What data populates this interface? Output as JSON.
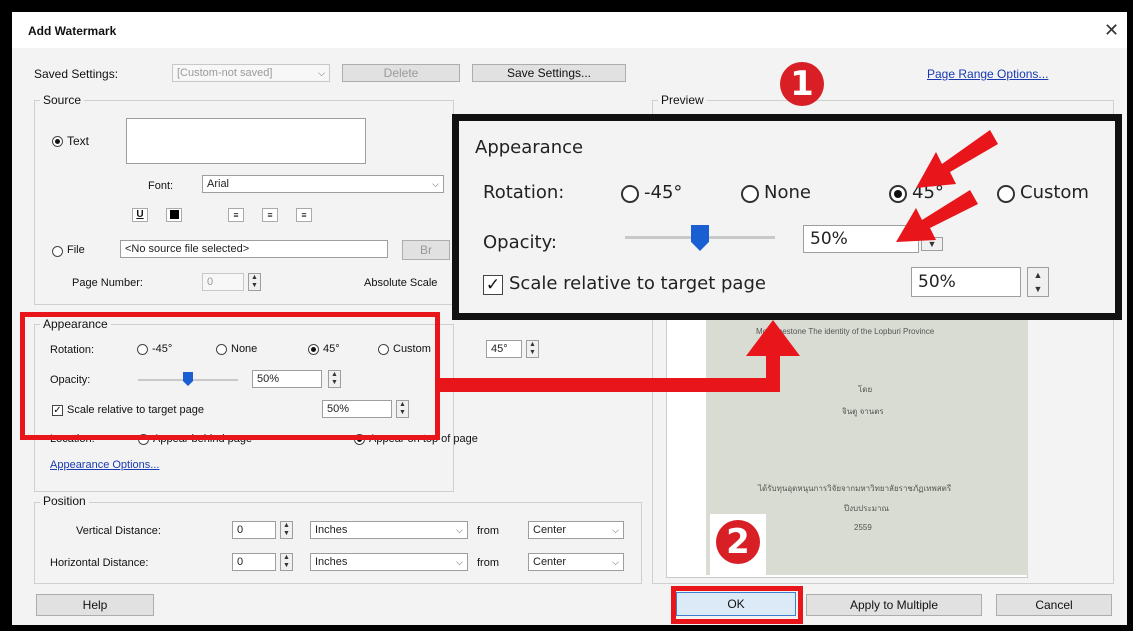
{
  "window": {
    "title": "Add Watermark",
    "close_glyph": "✕"
  },
  "saved_settings": {
    "label": "Saved Settings:",
    "value": "[Custom-not saved]",
    "delete": "Delete",
    "save": "Save Settings..."
  },
  "page_range_link": "Page Range Options...",
  "source": {
    "group_label": "Source",
    "text_option": "Text",
    "font_label": "Font:",
    "font_value": "Arial",
    "underline_glyph": "U",
    "file_option": "File",
    "file_value": "<No source file selected>",
    "browse": "Br",
    "page_number_label": "Page Number:",
    "page_number_value": "0",
    "absolute_scale_label": "Absolute Scale"
  },
  "appearance": {
    "group_label": "Appearance",
    "rotation_label": "Rotation:",
    "rot_m45": "-45°",
    "rot_none": "None",
    "rot_45": "45°",
    "rot_custom": "Custom",
    "custom_value": "45°",
    "opacity_label": "Opacity:",
    "opacity_value": "50%",
    "opacity_level": 0.5,
    "scale_label": "Scale relative to target page",
    "scale_value": "50%",
    "location_label": "Location:",
    "loc_behind": "Appear behind page",
    "loc_top": "Appear on top of page",
    "options_link": "Appearance Options..."
  },
  "position": {
    "group_label": "Position",
    "vertical_label": "Vertical Distance:",
    "horizontal_label": "Horizontal Distance:",
    "v_value": "0",
    "h_value": "0",
    "unit": "Inches",
    "from": "from",
    "anchor": "Center"
  },
  "preview": {
    "group_label": "Preview",
    "line1": "Mo  Limestone The identity of the  Lopburi Province",
    "line2": "โดย",
    "line3": "จินตู  จานตร",
    "line4": "ได้รับทุนอุดหนุนการวิจัยจากมหาวิทยาลัยราชภัฏเทพสตรี",
    "line5": "ปีงบประมาณ",
    "line6": "2559"
  },
  "zoom": {
    "title": "Appearance",
    "rotation_label": "Rotation:",
    "rot_m45": "-45°",
    "rot_none": "None",
    "rot_45": "45°",
    "rot_custom": "Custom",
    "opacity_label": "Opacity:",
    "opacity_value": "50%",
    "opacity_level": 0.5,
    "scale_label": "Scale relative to target page",
    "scale_value": "50%"
  },
  "badges": {
    "one": "1",
    "two": "2"
  },
  "buttons": {
    "help": "Help",
    "ok": "OK",
    "apply": "Apply to Multiple",
    "cancel": "Cancel"
  },
  "colors": {
    "annotation_red": "#e8161b",
    "badge_red": "#d81f26",
    "link_blue": "#1a3ab0",
    "slider_blue": "#1a5fd1"
  }
}
